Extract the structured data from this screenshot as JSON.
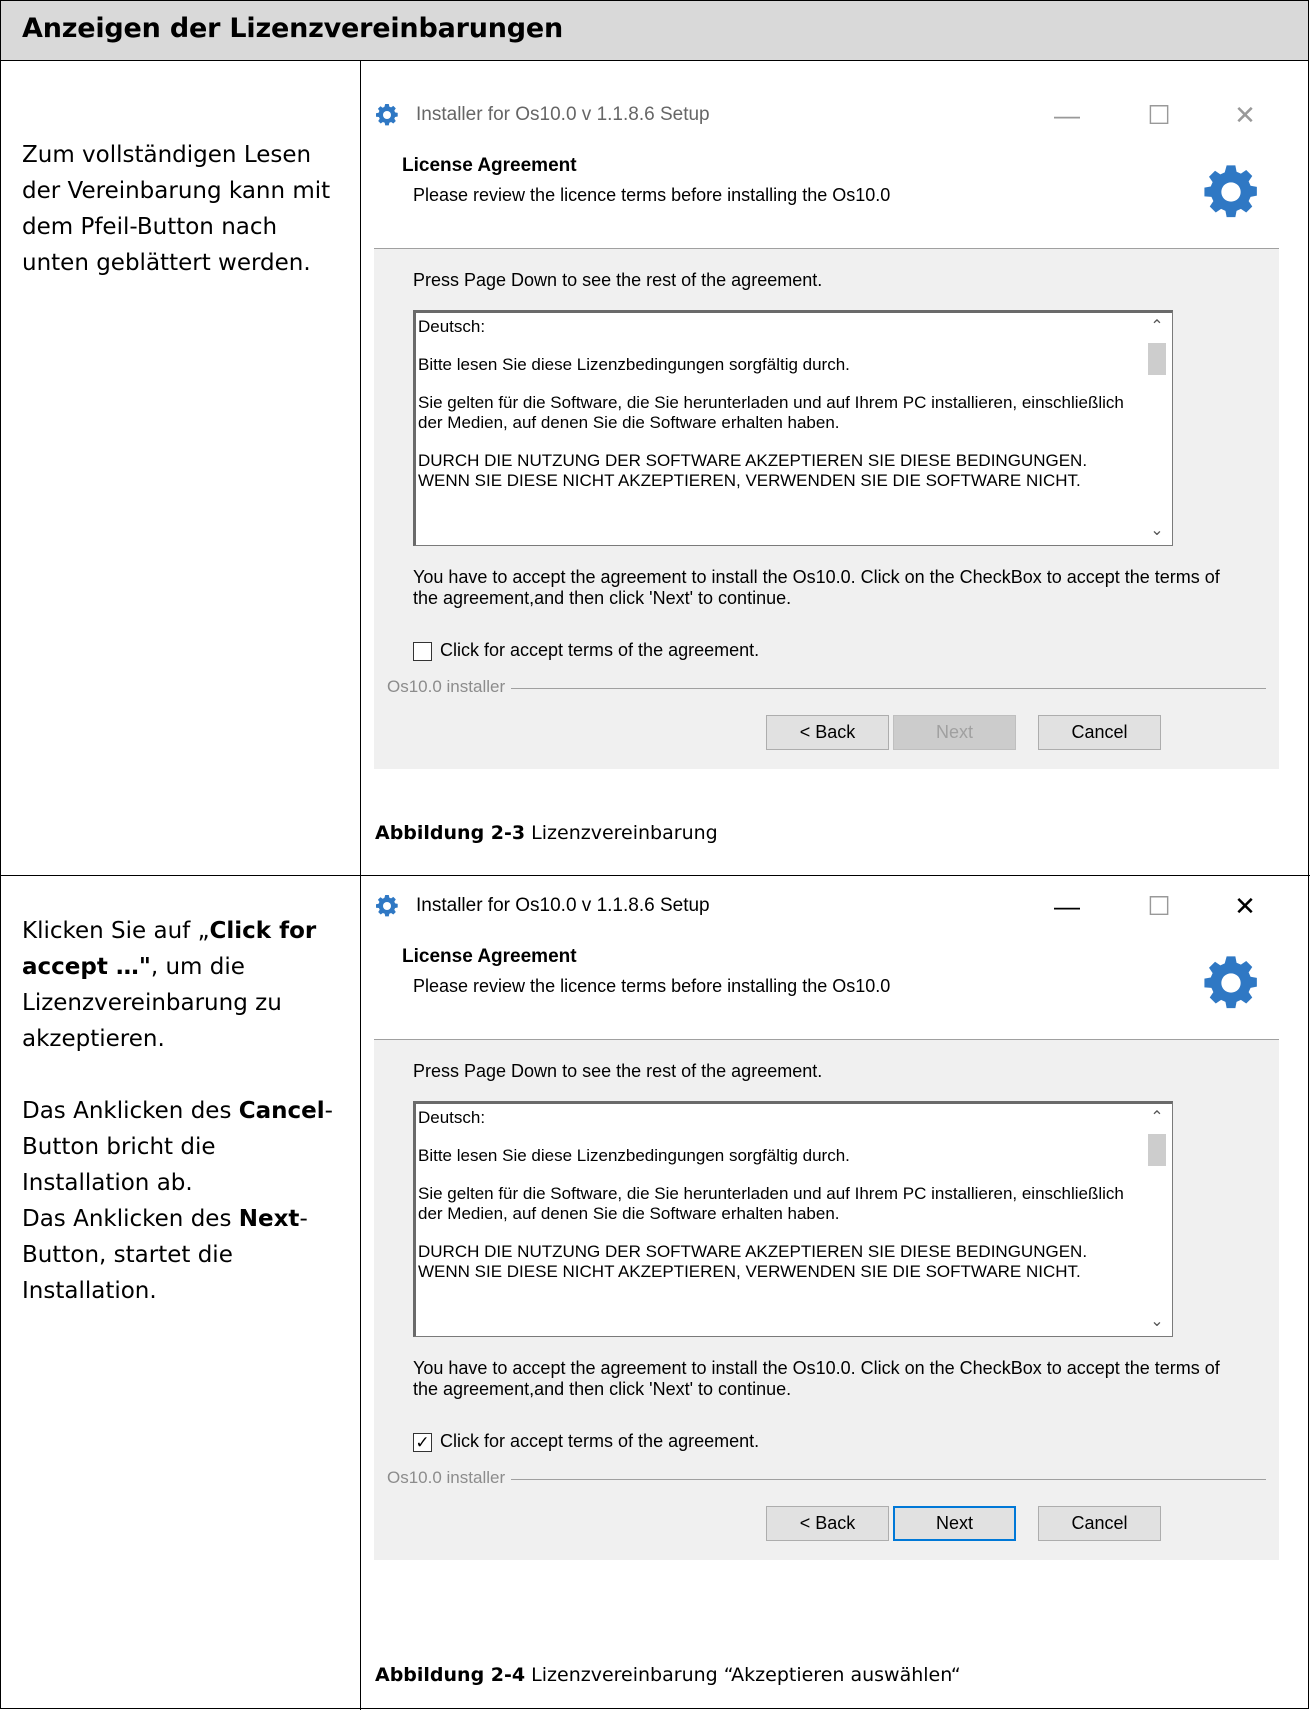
{
  "doc": {
    "title": "Anzeigen der Lizenzvereinbarungen"
  },
  "rows": [
    {
      "left_text": "Zum vollständigen Lesen der Vereinbarung kann mit dem Pfeil-Button nach unten geblättert werden.",
      "caption_bold": "Abbildung 2-3",
      "caption_text": " Lizenzvereinbarung"
    },
    {
      "left_p1_a": "Klicken Sie auf „",
      "left_p1_b": "Click for accept  …\"",
      "left_p1_c": ", um die Lizenzvereinbarung zu akzeptieren.",
      "left_p2_a": "Das Anklicken des ",
      "left_p2_b": "Cancel",
      "left_p2_c": "-Button bricht die Installation ab.",
      "left_p3_a": "Das Anklicken des ",
      "left_p3_b": "Next",
      "left_p3_c": "-Button, startet die Installation.",
      "caption_bold": "Abbildung 2-4",
      "caption_text": " Lizenzvereinbarung “Akzeptieren auswählen“"
    }
  ],
  "installer": {
    "window_title": "Installer for Os10.0 v 1.1.8.6 Setup",
    "minimize": "—",
    "maximize": "☐",
    "close": "✕",
    "heading": "License Agreement",
    "subheading": "Please review the licence terms before installing the Os10.0",
    "press_text": "Press Page Down to see the rest of the agreement.",
    "license_lines": [
      "Deutsch:",
      "Bitte lesen Sie diese Lizenzbedingungen sorgfältig durch.",
      "Sie gelten für die Software, die Sie herunterladen und auf Ihrem PC installieren, einschließlich der Medien, auf denen Sie die Software erhalten haben.",
      "DURCH DIE NUTZUNG DER SOFTWARE AKZEPTIEREN SIE DIESE BEDINGUNGEN. WENN SIE DIESE NICHT AKZEPTIEREN, VERWENDEN SIE DIE SOFTWARE NICHT."
    ],
    "scroll_up": "⌃",
    "scroll_down": "⌄",
    "accept_text": "You have to accept the agreement to install the Os10.0. Click on the CheckBox to accept the terms of the agreement,and then  click 'Next' to continue.",
    "checkbox_label": "Click for accept terms of the agreement.",
    "brand_label": "Os10.0 installer",
    "back_label": "< Back",
    "next_label": "Next",
    "cancel_label": "Cancel",
    "check_mark": "✓"
  },
  "states": [
    {
      "checkbox_checked": false,
      "next_enabled": false
    },
    {
      "checkbox_checked": true,
      "next_enabled": true
    }
  ],
  "colors": {
    "gear_blue": "#2f78c4",
    "focus_blue": "#0078d7",
    "header_gray": "#d9d9d9"
  }
}
